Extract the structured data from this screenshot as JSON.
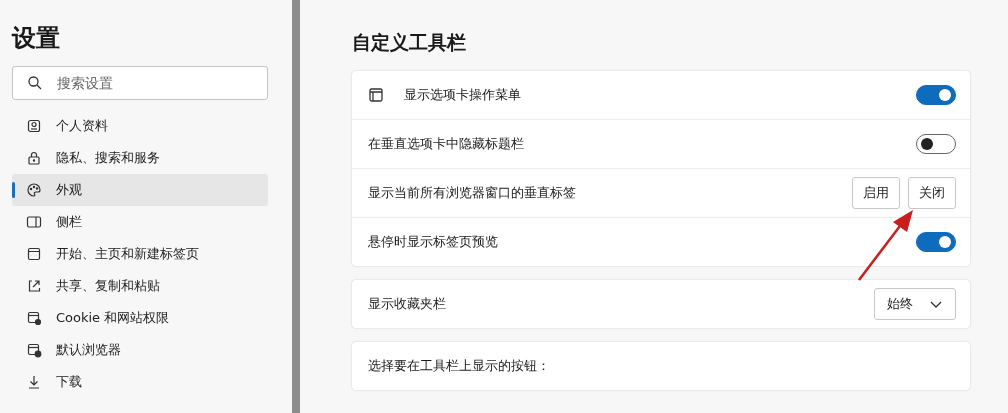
{
  "sidebar": {
    "title": "设置",
    "search": {
      "placeholder": "搜索设置"
    },
    "items": [
      {
        "label": "个人资料",
        "selected": false
      },
      {
        "label": "隐私、搜索和服务",
        "selected": false
      },
      {
        "label": "外观",
        "selected": true
      },
      {
        "label": "侧栏",
        "selected": false
      },
      {
        "label": "开始、主页和新建标签页",
        "selected": false
      },
      {
        "label": "共享、复制和粘贴",
        "selected": false
      },
      {
        "label": "Cookie 和网站权限",
        "selected": false
      },
      {
        "label": "默认浏览器",
        "selected": false
      },
      {
        "label": "下载",
        "selected": false
      }
    ]
  },
  "main": {
    "heading": "自定义工具栏",
    "cards": [
      {
        "rows": [
          {
            "kind": "toggle",
            "label": "显示选项卡操作菜单",
            "on": true
          },
          {
            "kind": "toggle",
            "label": "在垂直选项卡中隐藏标题栏",
            "on": false
          },
          {
            "kind": "buttons",
            "label": "显示当前所有浏览器窗口的垂直标签",
            "buttons": [
              "启用",
              "关闭"
            ]
          },
          {
            "kind": "toggle",
            "label": "悬停时显示标签页预览",
            "on": true
          }
        ]
      },
      {
        "rows": [
          {
            "kind": "dropdown",
            "label": "显示收藏夹栏",
            "value": "始终"
          }
        ]
      },
      {
        "rows": [
          {
            "kind": "text",
            "label": "选择要在工具栏上显示的按钮："
          }
        ]
      }
    ]
  }
}
